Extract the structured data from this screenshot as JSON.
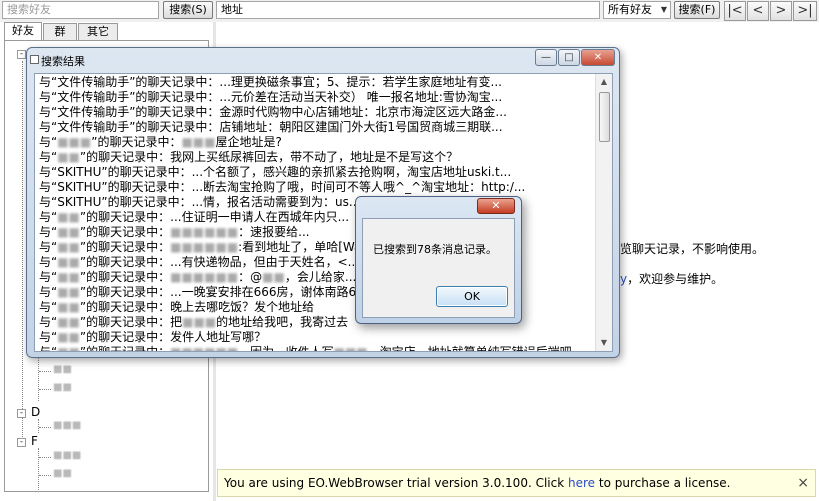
{
  "toolbar": {
    "friend_search_placeholder": "搜索好友",
    "friend_search_button": "搜索(S)",
    "keyword_value": "地址",
    "scope_select": "所有好友",
    "keyword_search_button": "搜索(F)",
    "nav": [
      "|<",
      "<",
      ">",
      ">|"
    ]
  },
  "left_tabs": [
    "好友",
    "群",
    "其它"
  ],
  "tree": {
    "letters": [
      "D",
      "F"
    ],
    "expanders": [
      "-",
      "-",
      "-"
    ]
  },
  "right_pane": {
    "line1_fragment": "览聊天记录，不影响使用。",
    "line2_link": "y",
    "line2_fragment": "，欢迎参与维护。"
  },
  "banner": {
    "text_before": "You are using EO.WebBrowser trial version 3.0.100. Click ",
    "link": "here",
    "text_after": " to purchase a license.",
    "close": "×"
  },
  "results_window": {
    "title": "搜索结果",
    "minimize": "—",
    "maximize": "□",
    "close": "✕",
    "lines": [
      [
        "与“文件传输助手”的聊天记录中：...理更换磁条事宜；5、提示：若学生家庭地址有变...",
        ""
      ],
      [
        "与“文件传输助手”的聊天记录中：...元价差在活动当天补交） 唯一报名地址:雪协淘宝...",
        ""
      ],
      [
        "与“文件传输助手”的聊天记录中：金源时代购物中心店铺地址：北京市海淀区远大路金...",
        ""
      ],
      [
        "与“文件传输助手”的聊天记录中：店铺地址：朝阳区建国门外大街1号国贸商城三期联...",
        ""
      ],
      [
        "与“",
        "■■■",
        "”的聊天记录中：",
        "■■■",
        "屋企地址是?"
      ],
      [
        "与“",
        "■■",
        "”的聊天记录中：我网上买纸尿裤回去，带不动了，地址是不是写这个？"
      ],
      [
        "与“SKITHU”的聊天记录中：...个名额了，感兴趣的亲抓紧去抢购啊，淘宝店地址uski.t..."
      ],
      [
        "与“SKITHU”的聊天记录中：...断去淘宝抢购了哦，时间可不等人哦^_^淘宝地址：http:/..."
      ],
      [
        "与“SKITHU”的聊天记录中：...情，报名活动需要到",
        "",
        "为：us..."
      ],
      [
        "与“",
        "■■",
        "”的聊天记录中：...住证明一申请人在西城",
        "",
        "年内只..."
      ],
      [
        "与“",
        "■■",
        "”的聊天记录中：",
        "■■■■■■",
        "：速报",
        "",
        "要给..."
      ],
      [
        "与“",
        "■■",
        "”的聊天记录中：",
        "■■■■■■",
        ":看到地址了，",
        "",
        "单哈[Wa..."
      ],
      [
        "与“",
        "■■",
        "”的聊天记录中：...有快递物品，但由于天",
        "",
        "姓名，<..."
      ],
      [
        "与“",
        "■■",
        "”的聊天记录中：",
        "■■■■■■",
        "：@",
        "■■",
        "，",
        "",
        "会儿给家..."
      ],
      [
        "与“",
        "■■",
        "”的聊天记录中：...一晚宴安排在666房，谢",
        "",
        "体南路6..."
      ],
      [
        "与“",
        "■■",
        "”的聊天记录中：晚上去哪吃饭？发个地址给",
        "",
        ""
      ],
      [
        "与“",
        "■■",
        "”的聊天记录中：把",
        "■■■",
        "的地址给我吧，我寄过去"
      ],
      [
        "与“",
        "■■",
        "”的聊天记录中：发件人地址写哪？"
      ],
      [
        "与“",
        "■■",
        "”的聊天记录中：",
        "■■■■■■",
        "，因为...收件人写",
        "■■■",
        "，淘宝店，地址就算单纯写错误后端吧"
      ]
    ]
  },
  "dialog": {
    "close": "✕",
    "message": "已搜索到78条消息记录。",
    "ok": "OK"
  }
}
